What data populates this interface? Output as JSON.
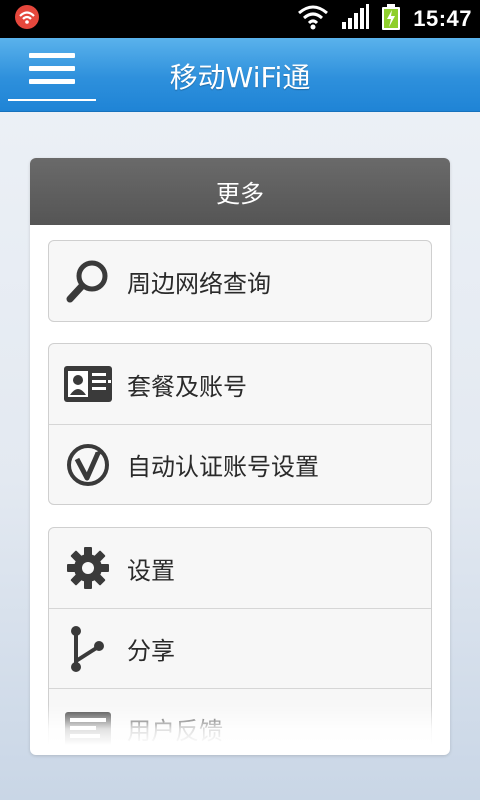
{
  "status_bar": {
    "time": "15:47",
    "icons": [
      "app-notification-icon",
      "wifi-signal-icon",
      "cell-signal-icon",
      "battery-charging-icon"
    ]
  },
  "app_bar": {
    "title": "移动WiFi通",
    "menu_icon": "hamburger-menu-icon"
  },
  "panel": {
    "header": "更多",
    "groups": [
      {
        "items": [
          {
            "label": "周边网络查询",
            "icon": "search-icon"
          }
        ]
      },
      {
        "items": [
          {
            "label": "套餐及账号",
            "icon": "id-card-icon"
          },
          {
            "label": "自动认证账号设置",
            "icon": "v-circle-icon"
          }
        ]
      },
      {
        "items": [
          {
            "label": "设置",
            "icon": "gear-icon"
          },
          {
            "label": "分享",
            "icon": "share-icon"
          },
          {
            "label": "用户反馈",
            "icon": "feedback-icon"
          }
        ]
      }
    ]
  },
  "colors": {
    "app_bar": "#2e90dc",
    "header": "#5e5e5e",
    "icon": "#3a3a3a"
  }
}
